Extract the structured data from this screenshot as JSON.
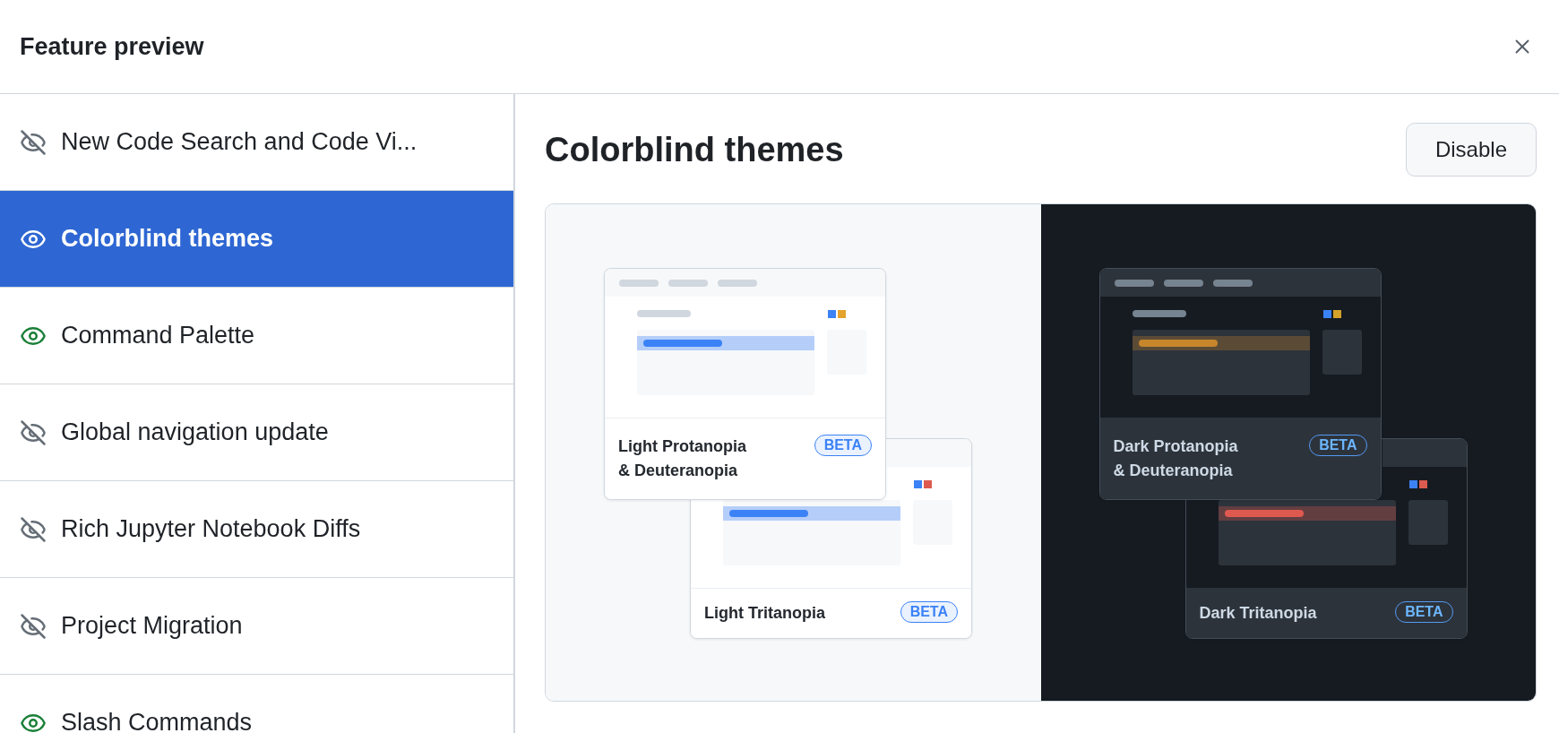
{
  "dialog": {
    "title": "Feature preview"
  },
  "sidebar": {
    "items": [
      {
        "label": "New Code Search and Code Vi...",
        "enabled": false,
        "selected": false
      },
      {
        "label": "Colorblind themes",
        "enabled": true,
        "selected": true
      },
      {
        "label": "Command Palette",
        "enabled": true,
        "selected": false
      },
      {
        "label": "Global navigation update",
        "enabled": false,
        "selected": false
      },
      {
        "label": "Rich Jupyter Notebook Diffs",
        "enabled": false,
        "selected": false
      },
      {
        "label": "Project Migration",
        "enabled": false,
        "selected": false
      },
      {
        "label": "Slash Commands",
        "enabled": true,
        "selected": false
      }
    ]
  },
  "detail": {
    "title": "Colorblind themes",
    "button": "Disable",
    "themes": [
      {
        "name": "Light Protanopia\n& Deuteranopia",
        "kind": "light",
        "highlight": {
          "color": "#3b82f6"
        },
        "swatches": [
          {
            "color": "#3b82f6"
          },
          {
            "color": "#e3a32c"
          }
        ],
        "badge": "BETA"
      },
      {
        "name": "Light Tritanopia",
        "kind": "light",
        "highlight": {
          "color": "#3b82f6"
        },
        "swatches": [
          {
            "color": "#3b82f6"
          },
          {
            "color": "#dc5a4f"
          }
        ],
        "badge": "BETA"
      },
      {
        "name": "Dark Protanopia\n& Deuteranopia",
        "kind": "dark",
        "highlight": {
          "color": "#c7862c"
        },
        "swatches": [
          {
            "color": "#3b82f6"
          },
          {
            "color": "#d4a12a"
          }
        ],
        "badge": "BETA"
      },
      {
        "name": "Dark Tritanopia",
        "kind": "dark",
        "highlight": {
          "color": "#e0594f"
        },
        "swatches": [
          {
            "color": "#3b82f6"
          },
          {
            "color": "#dc5a4f"
          }
        ],
        "badge": "BETA"
      }
    ]
  }
}
